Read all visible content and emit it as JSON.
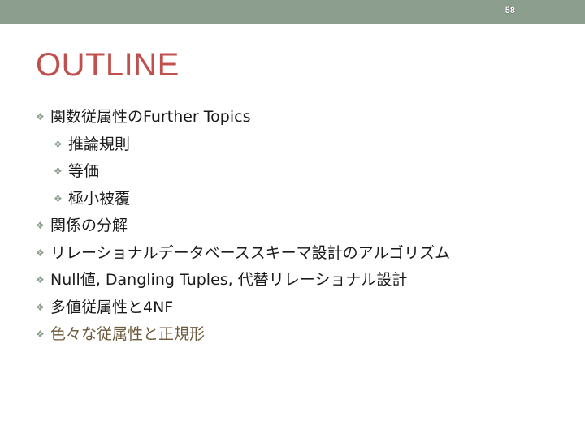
{
  "slide": {
    "page_number": "58",
    "title": "OUTLINE",
    "bullet_icon": "diamond-bullet-icon",
    "accent_color": "#c0504d",
    "bar_color": "#8c9f8e",
    "items": [
      {
        "text": "関数従属性のFurther Topics",
        "level": 1
      },
      {
        "text": "推論規則",
        "level": 2
      },
      {
        "text": "等価",
        "level": 2
      },
      {
        "text": "極小被覆",
        "level": 2
      },
      {
        "text": "関係の分解",
        "level": 1
      },
      {
        "text": "リレーショナルデータベーススキーマ設計のアルゴリズム",
        "level": 1
      },
      {
        "text": "Null値, Dangling Tuples, 代替リレーショナル設計",
        "level": 1
      },
      {
        "text": "多値従属性と4NF",
        "level": 1
      },
      {
        "text": "色々な従属性と正規形",
        "level": 1
      }
    ]
  }
}
